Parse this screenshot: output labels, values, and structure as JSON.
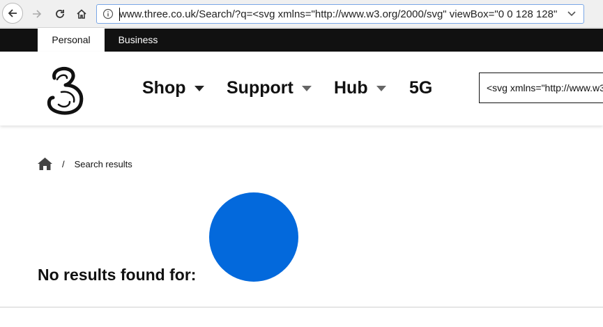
{
  "browser": {
    "url": "www.three.co.uk/Search/?q=<svg xmlns=\"http://www.w3.org/2000/svg\" viewBox=\"0 0 128 128\"",
    "icons": [
      "back-arrow-icon",
      "forward-arrow-icon",
      "reload-icon",
      "home-icon",
      "info-icon",
      "chevron-down-icon"
    ]
  },
  "site_topbar": {
    "tabs": [
      {
        "label": "Personal",
        "active": true
      },
      {
        "label": "Business",
        "active": false
      }
    ]
  },
  "header": {
    "logo": "three-logo",
    "nav": [
      {
        "label": "Shop",
        "has_dropdown": true
      },
      {
        "label": "Support",
        "has_dropdown": true
      },
      {
        "label": "Hub",
        "has_dropdown": true
      },
      {
        "label": "5G",
        "has_dropdown": false
      }
    ],
    "search_value": "<svg xmlns=\"http://www.w3"
  },
  "breadcrumb": {
    "separator": "/",
    "current": "Search results"
  },
  "results": {
    "heading": "No results found for:"
  },
  "colors": {
    "topbar_bg": "#111111",
    "blue_circle": "#0369dc",
    "url_focus_border": "#7aa7e6",
    "nav_caret_dark": "#222222",
    "nav_caret_light": "#666666"
  }
}
